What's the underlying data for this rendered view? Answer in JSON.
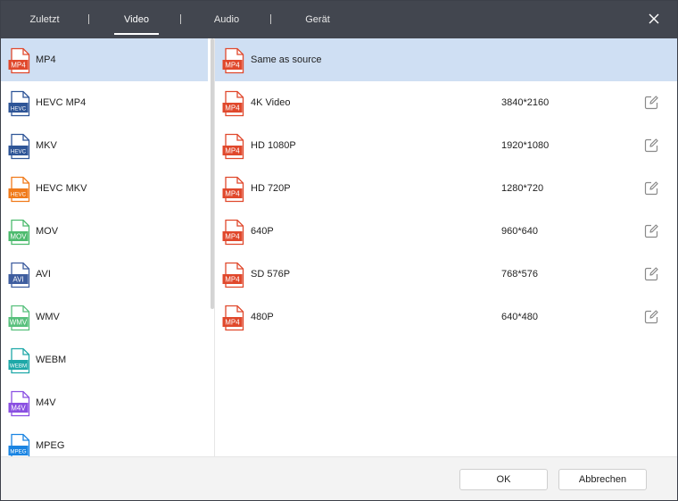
{
  "header": {
    "tabs": [
      {
        "label": "Zuletzt"
      },
      {
        "label": "Video"
      },
      {
        "label": "Audio"
      },
      {
        "label": "Gerät"
      }
    ],
    "active_tab": "Video"
  },
  "formats": [
    {
      "label": "MP4",
      "icon_text": "MP4",
      "color": "#e0482c",
      "selected": true
    },
    {
      "label": "HEVC MP4",
      "icon_text": "HEVC",
      "color": "#2e5597"
    },
    {
      "label": "MKV",
      "icon_text": "HEVC",
      "color": "#2e5597"
    },
    {
      "label": "HEVC MKV",
      "icon_text": "HEVC",
      "color": "#f07a1a"
    },
    {
      "label": "MOV",
      "icon_text": "MOV",
      "color": "#4dbb6e"
    },
    {
      "label": "AVI",
      "icon_text": "AVI",
      "color": "#3e5d9f"
    },
    {
      "label": "WMV",
      "icon_text": "WMV",
      "color": "#57c07c"
    },
    {
      "label": "WEBM",
      "icon_text": "WEBM",
      "color": "#1ea8a8"
    },
    {
      "label": "M4V",
      "icon_text": "M4V",
      "color": "#8a4fe2"
    },
    {
      "label": "MPEG",
      "icon_text": "MPEG",
      "color": "#1a84e2"
    }
  ],
  "presets": [
    {
      "name": "Same as source",
      "resolution": "",
      "selected": true
    },
    {
      "name": "4K Video",
      "resolution": "3840*2160"
    },
    {
      "name": "HD 1080P",
      "resolution": "1920*1080"
    },
    {
      "name": "HD 720P",
      "resolution": "1280*720"
    },
    {
      "name": "640P",
      "resolution": "960*640"
    },
    {
      "name": "SD 576P",
      "resolution": "768*576"
    },
    {
      "name": "480P",
      "resolution": "640*480"
    }
  ],
  "preset_icon": {
    "text": "MP4",
    "color": "#e0482c"
  },
  "footer": {
    "ok_label": "OK",
    "cancel_label": "Abbrechen"
  },
  "icons": {
    "close": "close-icon",
    "edit": "edit-icon",
    "file": "file-format-icon"
  }
}
